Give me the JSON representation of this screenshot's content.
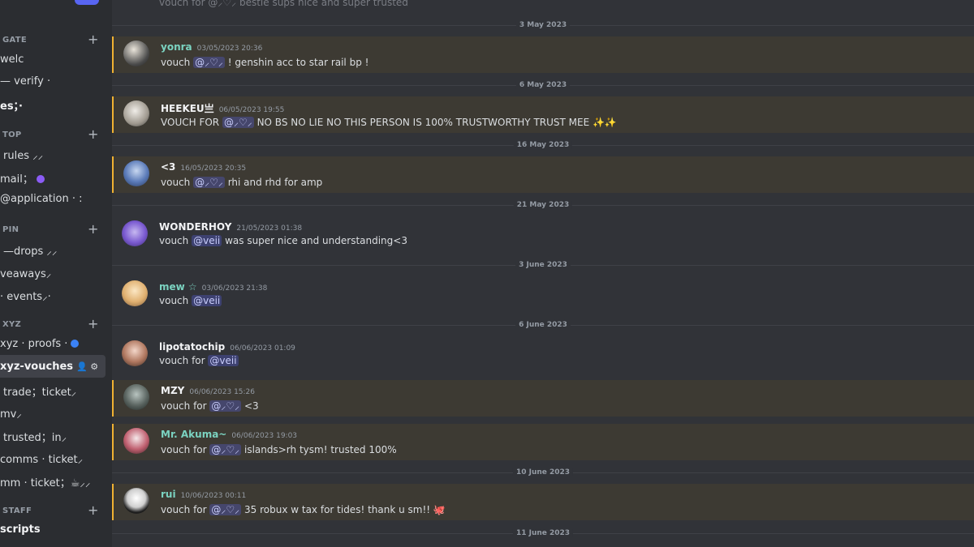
{
  "sidebar": {
    "categories": [
      {
        "label": "GATE"
      },
      {
        "label": "TOP"
      },
      {
        "label": "PIN"
      },
      {
        "label": "XYZ"
      },
      {
        "label": "STAFF"
      }
    ],
    "channels": [
      {
        "label": "welc"
      },
      {
        "label": "— verify ·"
      },
      {
        "label": "es；·"
      },
      {
        "label": "rules ⸝⸝"
      },
      {
        "label": "mail；"
      },
      {
        "label": "@application · :"
      },
      {
        "label": "—drops ⸝⸝"
      },
      {
        "label": "veaways⸝"
      },
      {
        "label": "· events⸝·"
      },
      {
        "label": "xyz · proofs ·"
      },
      {
        "label": "xyz-vouches"
      },
      {
        "label": "trade；ticket⸝"
      },
      {
        "label": "mv⸝"
      },
      {
        "label": "trusted；in⸝"
      },
      {
        "label": "comms · ticket⸝"
      },
      {
        "label": "mm · ticket；☕⸝⸝"
      },
      {
        "label": "scripts"
      }
    ]
  },
  "chat": {
    "top_partial": "vouch for @⸝♡⸝ bestie sups nice and super trusted",
    "dates": [
      "3 May 2023",
      "6 May 2023",
      "16 May 2023",
      "21 May 2023",
      "3 June 2023",
      "6 June 2023",
      "10 June 2023",
      "11 June 2023"
    ],
    "messages": [
      {
        "user": "yonra",
        "time": "03/05/2023 20:36",
        "pre": "vouch",
        "mention": "@⸝♡⸝",
        "post": "! genshin  acc to star rail bp !",
        "color": "#7bd3c1"
      },
      {
        "user": "HEEKEU亗",
        "time": "06/05/2023 19:55",
        "pre": "VOUCH FOR",
        "mention": "@⸝♡⸝",
        "post": "NO BS NO LIE NO THIS PERSON IS 100% TRUSTWORTHY TRUST MEE ✨✨",
        "color": "#f2f3f5"
      },
      {
        "user": "<3",
        "time": "16/05/2023 20:35",
        "pre": "vouch",
        "mention": "@⸝♡⸝",
        "post": "rhi and rhd for amp",
        "color": "#f2f3f5"
      },
      {
        "user": "WONDERHOY",
        "time": "21/05/2023 01:38",
        "pre": "vouch",
        "mention": "@veii",
        "post": "was super nice and understanding<3",
        "color": "#f2f3f5"
      },
      {
        "user": "mew ☆",
        "time": "03/06/2023 21:38",
        "pre": "vouch",
        "mention": "@veii",
        "post": "",
        "color": "#7bd3c1"
      },
      {
        "user": "lipotatochip",
        "time": "06/06/2023 01:09",
        "pre": "vouch for",
        "mention": "@veii",
        "post": "",
        "color": "#f2f3f5"
      },
      {
        "user": "MZY",
        "time": "06/06/2023 15:26",
        "pre": "vouch for",
        "mention": "@⸝♡⸝",
        "post": "<3",
        "color": "#f2f3f5"
      },
      {
        "user": "Mr. Akuma~",
        "time": "06/06/2023 19:03",
        "pre": "vouch for",
        "mention": "@⸝♡⸝",
        "post": "islands>rh tysm! trusted 100%",
        "color": "#7bd3c1"
      },
      {
        "user": "rui",
        "time": "10/06/2023 00:11",
        "pre": "vouch for",
        "mention": "@⸝♡⸝",
        "post": "35 robux w tax for tides! thank u sm!! 🐙",
        "color": "#f2f3f5"
      }
    ]
  },
  "colors": {
    "background": "#313338",
    "sidebar": "#2b2d31",
    "highlight": "#3d3a33",
    "highlight_bar": "#f0b232",
    "mention": "#5865f2"
  }
}
